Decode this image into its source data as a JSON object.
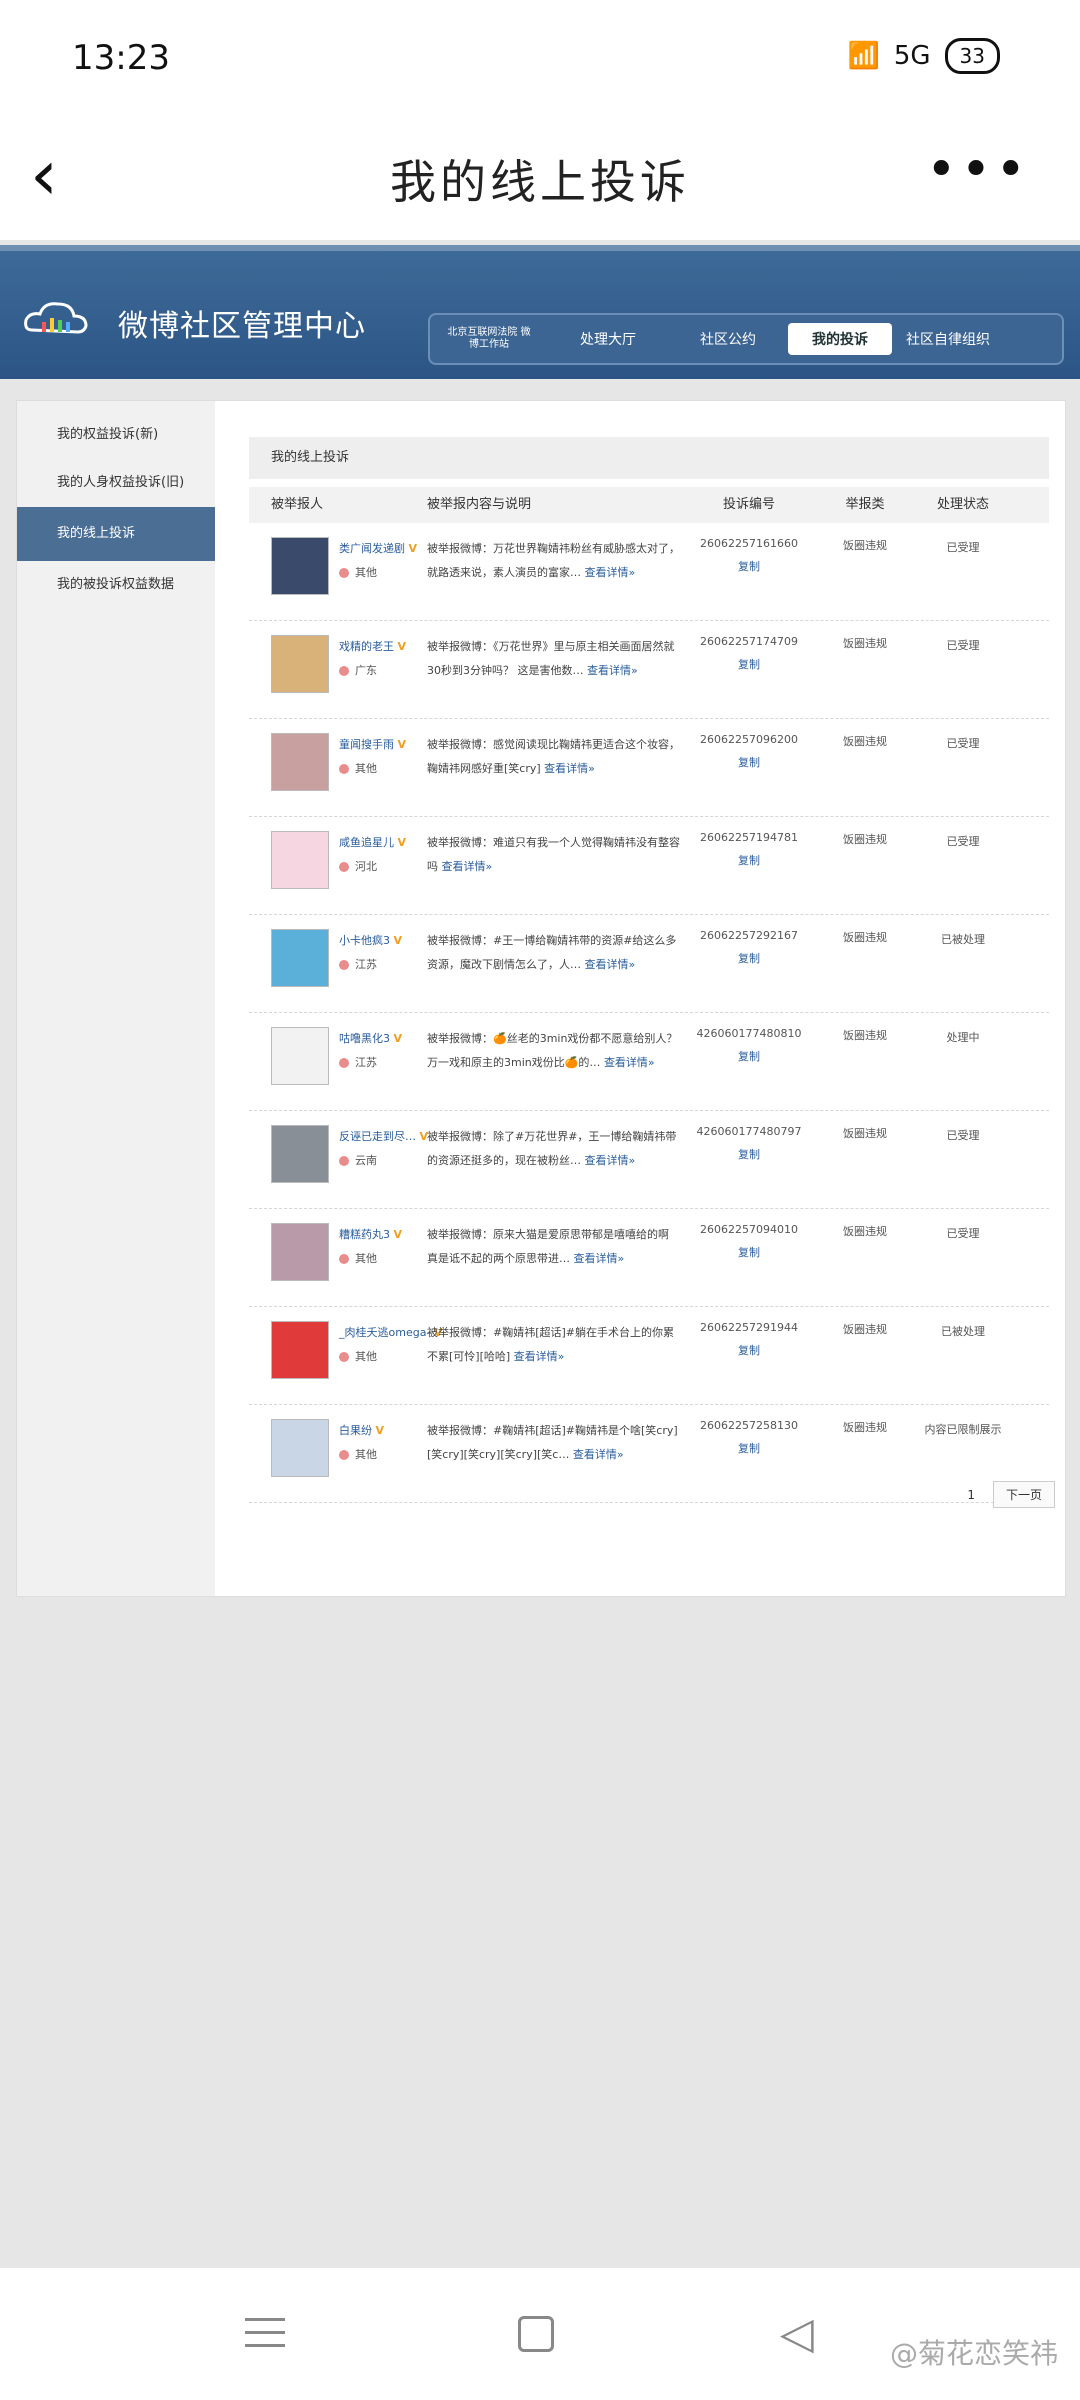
{
  "status": {
    "time": "13:23",
    "network": "5G",
    "battery": "33"
  },
  "nav": {
    "title": "我的线上投诉",
    "more": "•••",
    "back": "‹"
  },
  "header": {
    "brand": "微博社区管理中心",
    "menu": [
      {
        "label": "北京互联网法院 微博工作站"
      },
      {
        "label": "处理大厅"
      },
      {
        "label": "社区公约"
      },
      {
        "label": "我的投诉"
      },
      {
        "label": "社区自律组织"
      }
    ]
  },
  "sidebar": {
    "items": [
      {
        "label": "我的权益投诉(新)"
      },
      {
        "label": "我的人身权益投诉(旧)"
      },
      {
        "label": "我的线上投诉"
      },
      {
        "label": "我的被投诉权益数据"
      }
    ]
  },
  "panel": {
    "title": "我的线上投诉",
    "columns": [
      "被举报人",
      "被举报内容与说明",
      "投诉编号",
      "举报类",
      "处理状态"
    ]
  },
  "rows": [
    {
      "name": "类广闻发递剧",
      "loc": "其他",
      "content": "被举报微博：万花世界鞠婧祎粉丝有威胁感太对了，就路透来说，素人演员的富家…",
      "link": "查看详情»",
      "id": "2606225716166​0",
      "copy": "复制",
      "type": "饭圈违规",
      "status": "已受理"
    },
    {
      "name": "戏精的老王",
      "loc": "广东",
      "content": "被举报微博：《万花世界》里与原主相关画面居然就30秒到3分钟吗？ 这是害他数…",
      "link": "查看详情»",
      "id": "26062257174709",
      "copy": "复制",
      "type": "饭圈违规",
      "status": "已受理"
    },
    {
      "name": "童闻搜手雨",
      "loc": "其他",
      "content": "被举报微博：感觉阅读现比鞠婧祎更适合这个妆容，鞠婧祎网感好重[笑cry]",
      "link": "查看详情»",
      "id": "26062257096200",
      "copy": "复制",
      "type": "饭圈违规",
      "status": "已受理"
    },
    {
      "name": "咸鱼追星儿",
      "loc": "河北",
      "content": "被举报微博：难道只有我一个人觉得鞠婧祎没有整容吗",
      "link": "查看详情»",
      "id": "26062257194781",
      "copy": "复制",
      "type": "饭圈违规",
      "status": "已受理"
    },
    {
      "name": "小卡他疯3",
      "loc": "江苏",
      "content": "被举报微博：#王一博给鞠婧祎带的资源#给这么多资源，魔改下剧情怎么了，人…",
      "link": "查看详情»",
      "id": "26062257292167",
      "copy": "复制",
      "type": "饭圈违规",
      "status": "已被处理"
    },
    {
      "name": "咕噜黑化3",
      "loc": "江苏",
      "content": "被举报微博：🍊丝老的3min戏份都不愿意给别人？ 万一戏和原主的3min戏份比🍊的…",
      "link": "查看详情»",
      "id": "42606017748081​0",
      "copy": "复制",
      "type": "饭圈违规",
      "status": "处理中"
    },
    {
      "name": "反诬已走到尽…",
      "loc": "云南",
      "content": "被举报微博：除了#万花世界#，王一博给鞠婧祎带的资源还挺多的，现在被粉丝…",
      "link": "查看详情»",
      "id": "42606017748079​7",
      "copy": "复制",
      "type": "饭圈违规",
      "status": "已受理"
    },
    {
      "name": "糟糕药丸3",
      "loc": "其他",
      "content": "被举报微博：原来大猫是爱原思带郁是嘻嘻给的啊 真是诋不起的两个原思带进…",
      "link": "查看详情»",
      "id": "26062257094010",
      "copy": "复制",
      "type": "饭圈违规",
      "status": "已受理"
    },
    {
      "name": "_肉桂夭逃omega-",
      "loc": "其他",
      "content": "被举报微博：#鞠婧祎[超话]#躺在手术台上的你累不累[可怜][哈哈]",
      "link": "查看详情»",
      "id": "26062257291944",
      "copy": "复制",
      "type": "饭圈违规",
      "status": "已被处理"
    },
    {
      "name": "白果纷",
      "loc": "其他",
      "content": "被举报微博：#鞠婧祎[超话]#鞠婧祎是个啥[笑cry][笑cry][笑cry][笑cry][笑c…",
      "link": "查看详情»",
      "id": "26062257258130",
      "copy": "复制",
      "type": "饭圈违规",
      "status": "内容已限制展示"
    }
  ],
  "pager": {
    "page": "1",
    "next": "下一页"
  },
  "watermark": "@菊花恋笑祎",
  "colors": {
    "header": "#2c5585",
    "sidebar_active": "#4b6e95",
    "link": "#2a5d9c"
  }
}
